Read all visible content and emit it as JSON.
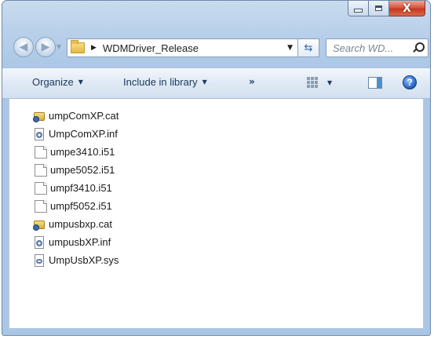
{
  "window": {
    "caption": {
      "minimize": "—",
      "maximize": "□",
      "close": "X"
    }
  },
  "nav": {
    "back_glyph": "◀",
    "forward_glyph": "▶",
    "recent_glyph": "▼",
    "crumb_separator": "▶",
    "folder_name": "WDMDriver_Release",
    "address_dropdown": "▼",
    "refresh_glyph": "⇆",
    "search_placeholder": "Search WD..."
  },
  "toolbar": {
    "organize": "Organize",
    "include_in_library": "Include in library",
    "more": "»",
    "dropdown_glyph": "▼",
    "help": "?"
  },
  "files": [
    {
      "name": "umpComXP.cat",
      "icon": "security-catalog-icon"
    },
    {
      "name": "UmpComXP.inf",
      "icon": "setup-information-icon"
    },
    {
      "name": "umpe3410.i51",
      "icon": "blank-document-icon"
    },
    {
      "name": "umpe5052.i51",
      "icon": "blank-document-icon"
    },
    {
      "name": "umpf3410.i51",
      "icon": "blank-document-icon"
    },
    {
      "name": "umpf5052.i51",
      "icon": "blank-document-icon"
    },
    {
      "name": "umpusbxp.cat",
      "icon": "security-catalog-icon"
    },
    {
      "name": "umpusbXP.inf",
      "icon": "setup-information-icon"
    },
    {
      "name": "UmpUsbXP.sys",
      "icon": "system-file-icon"
    }
  ]
}
